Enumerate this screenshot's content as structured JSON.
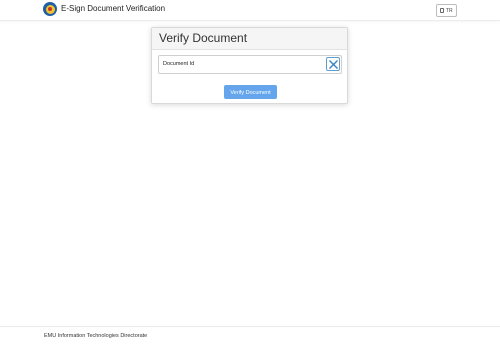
{
  "navbar": {
    "title": "E-Sign Document Verification",
    "language_button": "TR",
    "logo_icon": "university-seal-icon",
    "language_icon": "language-icon"
  },
  "card": {
    "title": "Verify Document",
    "input": {
      "label": "Document Id",
      "scan_icon": "qr-scan-icon"
    },
    "verify_button": "Verify Document"
  },
  "footer": {
    "text": "EMU Information Technologies Directorate"
  },
  "colors": {
    "primary_button": "#64a5ec",
    "scan_icon_blue": "#5d9fd1",
    "logo_blue": "#1f5fa6",
    "logo_gold": "#f3c233"
  }
}
